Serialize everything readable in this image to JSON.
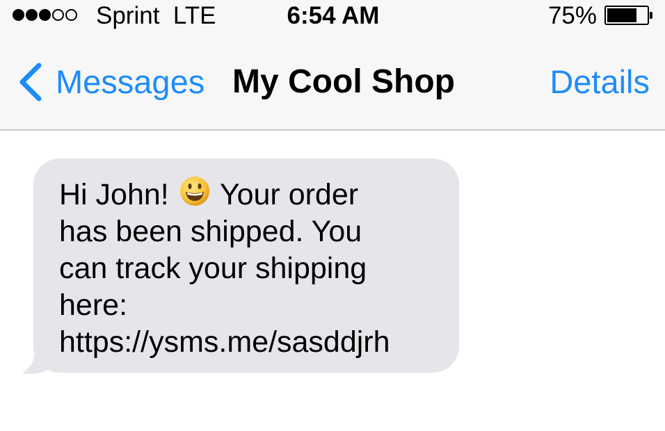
{
  "status_bar": {
    "signal_dots_filled": 3,
    "signal_dots_total": 5,
    "carrier": "Sprint  LTE",
    "time": "6:54 AM",
    "battery_percent_label": "75%",
    "battery_level": 0.75,
    "battery_icon": "battery-icon"
  },
  "nav_bar": {
    "back_label": "Messages",
    "back_icon": "chevron-left-icon",
    "title": "My Cool Shop",
    "details_label": "Details",
    "accent_color": "#1f8cf9"
  },
  "conversation": {
    "messages": [
      {
        "direction": "incoming",
        "text_before_emoji": "Hi John! ",
        "emoji": "grinning-face",
        "text_after_emoji": " Your order\nhas been shipped. You\ncan track your shipping\nhere:\nhttps://ysms.me/sasddjrh",
        "bubble_color": "#e5e5ea"
      }
    ]
  }
}
